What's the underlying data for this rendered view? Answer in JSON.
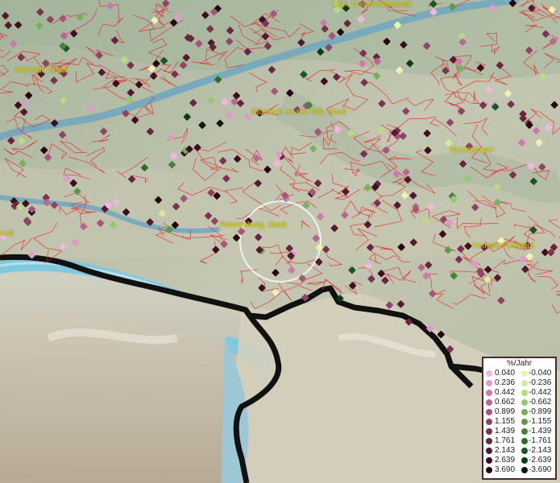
{
  "map": {
    "labels": [
      {
        "text": "Ulm, Universitätsstadt"
      },
      {
        "text": "Albstadt, Stadt"
      },
      {
        "text": "Biberach an der Riß, Stadt"
      },
      {
        "text": "Memmingen"
      },
      {
        "text": "Ravensburg, Stadt"
      },
      {
        "text": "Kempten (Allgäu)"
      },
      {
        "text": "tadt"
      }
    ]
  },
  "legend": {
    "title": "%/Jahr",
    "positive": [
      {
        "value": "0.040",
        "color": "#f0b8e0"
      },
      {
        "value": "0.236",
        "color": "#e09ac8"
      },
      {
        "value": "0.442",
        "color": "#cc7aac"
      },
      {
        "value": "0.662",
        "color": "#b86890"
      },
      {
        "value": "0.899",
        "color": "#a5567a"
      },
      {
        "value": "1.155",
        "color": "#904466"
      },
      {
        "value": "1.439",
        "color": "#7c3352"
      },
      {
        "value": "1.761",
        "color": "#682540"
      },
      {
        "value": "2.143",
        "color": "#541830"
      },
      {
        "value": "2.639",
        "color": "#3e0e20"
      },
      {
        "value": "3.690",
        "color": "#240410"
      }
    ],
    "negative": [
      {
        "value": "-0.040",
        "color": "#f2f2b0"
      },
      {
        "value": "-0.236",
        "color": "#d6ec9c"
      },
      {
        "value": "-0.442",
        "color": "#b8dc86"
      },
      {
        "value": "-0.662",
        "color": "#98c86e"
      },
      {
        "value": "-0.899",
        "color": "#7ab05a"
      },
      {
        "value": "-1.155",
        "color": "#5e9a48"
      },
      {
        "value": "-1.439",
        "color": "#448438"
      },
      {
        "value": "-1.761",
        "color": "#2e6e2a"
      },
      {
        "value": "-2.143",
        "color": "#1c561e"
      },
      {
        "value": "-2.639",
        "color": "#0e3c12"
      },
      {
        "value": "-3.690",
        "color": "#041e06"
      }
    ]
  }
}
